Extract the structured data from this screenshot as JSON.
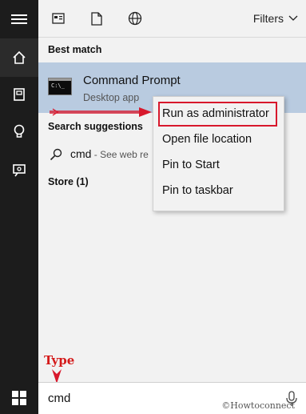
{
  "sidebar": {
    "items": [
      {
        "icon": "hamburger-menu-icon"
      },
      {
        "icon": "home-icon",
        "selected": true
      },
      {
        "icon": "notebook-icon"
      },
      {
        "icon": "lightbulb-icon"
      },
      {
        "icon": "feedback-icon"
      }
    ]
  },
  "topbar": {
    "icons": [
      "apps-icon",
      "documents-icon",
      "web-icon"
    ],
    "filters_label": "Filters"
  },
  "best_match": {
    "heading": "Best match",
    "app_name": "Command Prompt",
    "app_type": "Desktop app",
    "icon_text": "C:\\_",
    "icon": "command-prompt-icon"
  },
  "suggestions": {
    "heading": "Search suggestions",
    "query": "cmd",
    "hint": " - See web re"
  },
  "store": {
    "heading": "Store (1)"
  },
  "context_menu": {
    "items": [
      {
        "label": "Run as administrator",
        "highlighted": true
      },
      {
        "label": "Open file location"
      },
      {
        "label": "Pin to Start"
      },
      {
        "label": "Pin to taskbar"
      }
    ]
  },
  "search_box": {
    "value": "cmd",
    "icon": "microphone-icon"
  },
  "annotation": {
    "label": "Type",
    "color": "#d41a1a"
  },
  "watermark": "©Howtoconnect",
  "colors": {
    "sidebar_bg": "#1c1c1c",
    "panel_bg": "#f2f2f2",
    "selected_row": "#b9cbe0",
    "annotation_red": "#d8182c"
  }
}
